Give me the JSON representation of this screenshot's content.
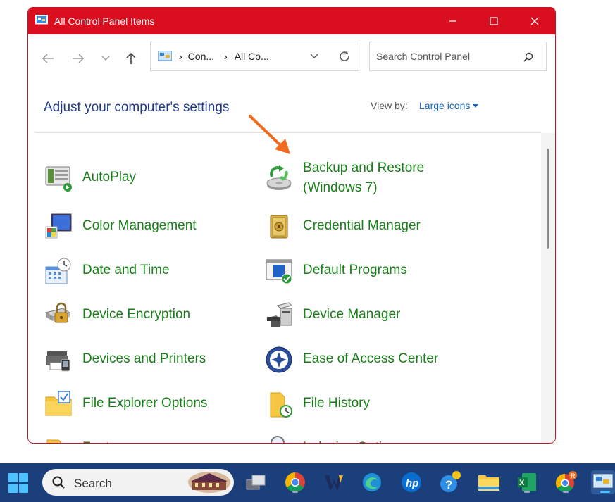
{
  "window": {
    "title": "All Control Panel Items",
    "titlebar_color": "#d90f20"
  },
  "address": {
    "crumbs": [
      "Con...",
      "All Co..."
    ]
  },
  "search": {
    "placeholder": "Search Control Panel"
  },
  "heading": "Adjust your computer's settings",
  "view_by": {
    "label": "View by:",
    "value": "Large icons"
  },
  "items": [
    {
      "label": "AutoPlay",
      "icon": "autoplay-icon"
    },
    {
      "label": "Backup and Restore\n(Windows 7)",
      "icon": "backup-restore-icon"
    },
    {
      "label": "Color Management",
      "icon": "color-management-icon"
    },
    {
      "label": "Credential Manager",
      "icon": "credential-manager-icon"
    },
    {
      "label": "Date and Time",
      "icon": "date-time-icon"
    },
    {
      "label": "Default Programs",
      "icon": "default-programs-icon"
    },
    {
      "label": "Device Encryption",
      "icon": "device-encryption-icon"
    },
    {
      "label": "Device Manager",
      "icon": "device-manager-icon"
    },
    {
      "label": "Devices and Printers",
      "icon": "devices-printers-icon"
    },
    {
      "label": "Ease of Access Center",
      "icon": "ease-of-access-icon"
    },
    {
      "label": "File Explorer Options",
      "icon": "file-explorer-options-icon"
    },
    {
      "label": "File History",
      "icon": "file-history-icon"
    },
    {
      "label": "Fonts",
      "icon": "fonts-icon"
    },
    {
      "label": "Indexing Options",
      "icon": "indexing-options-icon"
    }
  ],
  "taskbar": {
    "search_text": "Search",
    "apps": [
      "task-view-icon",
      "chrome-icon",
      "w-app-icon",
      "edge-icon",
      "hp-icon",
      "help-icon",
      "file-explorer-icon",
      "excel-icon",
      "chrome-profile-icon",
      "control-panel-icon"
    ]
  },
  "colors": {
    "item_text": "#1a7f1a",
    "heading_text": "#1e3a8a",
    "link": "#1565c0",
    "annotation_arrow": "#f26b1d",
    "taskbar": "#1b3f7a"
  }
}
